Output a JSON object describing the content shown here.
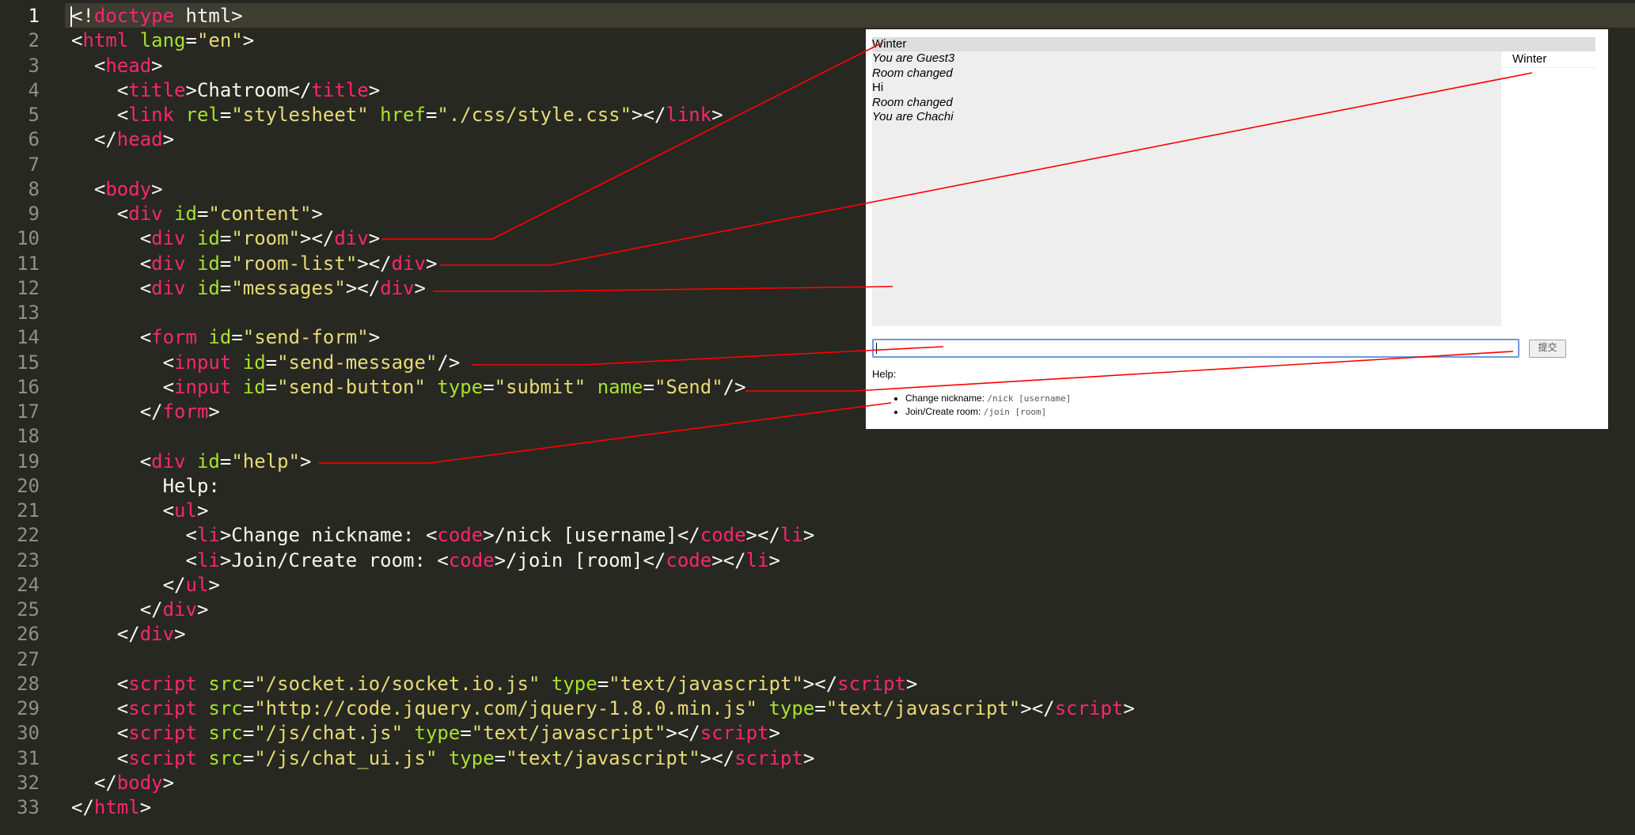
{
  "editor": {
    "line_numbers": [
      "1",
      "2",
      "3",
      "4",
      "5",
      "6",
      "7",
      "8",
      "9",
      "10",
      "11",
      "12",
      "13",
      "14",
      "15",
      "16",
      "17",
      "18",
      "19",
      "20",
      "21",
      "22",
      "23",
      "24",
      "25",
      "26",
      "27",
      "28",
      "29",
      "30",
      "31",
      "32",
      "33"
    ],
    "accent_colors": {
      "background": "#272822",
      "tag": "#f92672",
      "attr": "#a6e22e",
      "string": "#e6db74",
      "text": "#f8f8f2"
    },
    "lines": [
      [
        [
          "p",
          "<!"
        ],
        [
          "t",
          "doctype"
        ],
        [
          "p",
          " html>"
        ]
      ],
      [
        [
          "p",
          "<"
        ],
        [
          "t",
          "html"
        ],
        [
          "p",
          " "
        ],
        [
          "a",
          "lang"
        ],
        [
          "p",
          "="
        ],
        [
          "s",
          "\"en\""
        ],
        [
          "p",
          ">"
        ]
      ],
      [
        [
          "p",
          "  <"
        ],
        [
          "t",
          "head"
        ],
        [
          "p",
          ">"
        ]
      ],
      [
        [
          "p",
          "    <"
        ],
        [
          "t",
          "title"
        ],
        [
          "p",
          ">Chatroom</"
        ],
        [
          "t",
          "title"
        ],
        [
          "p",
          ">"
        ]
      ],
      [
        [
          "p",
          "    <"
        ],
        [
          "t",
          "link"
        ],
        [
          "p",
          " "
        ],
        [
          "a",
          "rel"
        ],
        [
          "p",
          "="
        ],
        [
          "s",
          "\"stylesheet\""
        ],
        [
          "p",
          " "
        ],
        [
          "a",
          "href"
        ],
        [
          "p",
          "="
        ],
        [
          "s",
          "\"./css/style.css\""
        ],
        [
          "p",
          "></"
        ],
        [
          "t",
          "link"
        ],
        [
          "p",
          ">"
        ]
      ],
      [
        [
          "p",
          "  </"
        ],
        [
          "t",
          "head"
        ],
        [
          "p",
          ">"
        ]
      ],
      [],
      [
        [
          "p",
          "  <"
        ],
        [
          "t",
          "body"
        ],
        [
          "p",
          ">"
        ]
      ],
      [
        [
          "p",
          "    <"
        ],
        [
          "t",
          "div"
        ],
        [
          "p",
          " "
        ],
        [
          "a",
          "id"
        ],
        [
          "p",
          "="
        ],
        [
          "s",
          "\"content\""
        ],
        [
          "p",
          ">"
        ]
      ],
      [
        [
          "p",
          "      <"
        ],
        [
          "t",
          "div"
        ],
        [
          "p",
          " "
        ],
        [
          "a",
          "id"
        ],
        [
          "p",
          "="
        ],
        [
          "s",
          "\"room\""
        ],
        [
          "p",
          "></"
        ],
        [
          "t",
          "div"
        ],
        [
          "p",
          ">"
        ]
      ],
      [
        [
          "p",
          "      <"
        ],
        [
          "t",
          "div"
        ],
        [
          "p",
          " "
        ],
        [
          "a",
          "id"
        ],
        [
          "p",
          "="
        ],
        [
          "s",
          "\"room-list\""
        ],
        [
          "p",
          "></"
        ],
        [
          "t",
          "div"
        ],
        [
          "p",
          ">"
        ]
      ],
      [
        [
          "p",
          "      <"
        ],
        [
          "t",
          "div"
        ],
        [
          "p",
          " "
        ],
        [
          "a",
          "id"
        ],
        [
          "p",
          "="
        ],
        [
          "s",
          "\"messages\""
        ],
        [
          "p",
          "></"
        ],
        [
          "t",
          "div"
        ],
        [
          "p",
          ">"
        ]
      ],
      [],
      [
        [
          "p",
          "      <"
        ],
        [
          "t",
          "form"
        ],
        [
          "p",
          " "
        ],
        [
          "a",
          "id"
        ],
        [
          "p",
          "="
        ],
        [
          "s",
          "\"send-form\""
        ],
        [
          "p",
          ">"
        ]
      ],
      [
        [
          "p",
          "        <"
        ],
        [
          "t",
          "input"
        ],
        [
          "p",
          " "
        ],
        [
          "a",
          "id"
        ],
        [
          "p",
          "="
        ],
        [
          "s",
          "\"send-message\""
        ],
        [
          "p",
          "/>"
        ]
      ],
      [
        [
          "p",
          "        <"
        ],
        [
          "t",
          "input"
        ],
        [
          "p",
          " "
        ],
        [
          "a",
          "id"
        ],
        [
          "p",
          "="
        ],
        [
          "s",
          "\"send-button\""
        ],
        [
          "p",
          " "
        ],
        [
          "a",
          "type"
        ],
        [
          "p",
          "="
        ],
        [
          "s",
          "\"submit\""
        ],
        [
          "p",
          " "
        ],
        [
          "a",
          "name"
        ],
        [
          "p",
          "="
        ],
        [
          "s",
          "\"Send\""
        ],
        [
          "p",
          "/>"
        ]
      ],
      [
        [
          "p",
          "      </"
        ],
        [
          "t",
          "form"
        ],
        [
          "p",
          ">"
        ]
      ],
      [],
      [
        [
          "p",
          "      <"
        ],
        [
          "t",
          "div"
        ],
        [
          "p",
          " "
        ],
        [
          "a",
          "id"
        ],
        [
          "p",
          "="
        ],
        [
          "s",
          "\"help\""
        ],
        [
          "p",
          ">"
        ]
      ],
      [
        [
          "p",
          "        Help:"
        ]
      ],
      [
        [
          "p",
          "        <"
        ],
        [
          "t",
          "ul"
        ],
        [
          "p",
          ">"
        ]
      ],
      [
        [
          "p",
          "          <"
        ],
        [
          "t",
          "li"
        ],
        [
          "p",
          ">Change nickname: <"
        ],
        [
          "t",
          "code"
        ],
        [
          "p",
          ">/nick [username]</"
        ],
        [
          "t",
          "code"
        ],
        [
          "p",
          "></"
        ],
        [
          "t",
          "li"
        ],
        [
          "p",
          ">"
        ]
      ],
      [
        [
          "p",
          "          <"
        ],
        [
          "t",
          "li"
        ],
        [
          "p",
          ">Join/Create room: <"
        ],
        [
          "t",
          "code"
        ],
        [
          "p",
          ">/join [room]</"
        ],
        [
          "t",
          "code"
        ],
        [
          "p",
          "></"
        ],
        [
          "t",
          "li"
        ],
        [
          "p",
          ">"
        ]
      ],
      [
        [
          "p",
          "        </"
        ],
        [
          "t",
          "ul"
        ],
        [
          "p",
          ">"
        ]
      ],
      [
        [
          "p",
          "      </"
        ],
        [
          "t",
          "div"
        ],
        [
          "p",
          ">"
        ]
      ],
      [
        [
          "p",
          "    </"
        ],
        [
          "t",
          "div"
        ],
        [
          "p",
          ">"
        ]
      ],
      [],
      [
        [
          "p",
          "    <"
        ],
        [
          "t",
          "script"
        ],
        [
          "p",
          " "
        ],
        [
          "a",
          "src"
        ],
        [
          "p",
          "="
        ],
        [
          "s",
          "\"/socket.io/socket.io.js\""
        ],
        [
          "p",
          " "
        ],
        [
          "a",
          "type"
        ],
        [
          "p",
          "="
        ],
        [
          "s",
          "\"text/javascript\""
        ],
        [
          "p",
          "></"
        ],
        [
          "t",
          "script"
        ],
        [
          "p",
          ">"
        ]
      ],
      [
        [
          "p",
          "    <"
        ],
        [
          "t",
          "script"
        ],
        [
          "p",
          " "
        ],
        [
          "a",
          "src"
        ],
        [
          "p",
          "="
        ],
        [
          "s",
          "\"http://code.jquery.com/jquery-1.8.0.min.js\""
        ],
        [
          "p",
          " "
        ],
        [
          "a",
          "type"
        ],
        [
          "p",
          "="
        ],
        [
          "s",
          "\"text/javascript\""
        ],
        [
          "p",
          "></"
        ],
        [
          "t",
          "script"
        ],
        [
          "p",
          ">"
        ]
      ],
      [
        [
          "p",
          "    <"
        ],
        [
          "t",
          "script"
        ],
        [
          "p",
          " "
        ],
        [
          "a",
          "src"
        ],
        [
          "p",
          "="
        ],
        [
          "s",
          "\"/js/chat.js\""
        ],
        [
          "p",
          " "
        ],
        [
          "a",
          "type"
        ],
        [
          "p",
          "="
        ],
        [
          "s",
          "\"text/javascript\""
        ],
        [
          "p",
          "></"
        ],
        [
          "t",
          "script"
        ],
        [
          "p",
          ">"
        ]
      ],
      [
        [
          "p",
          "    <"
        ],
        [
          "t",
          "script"
        ],
        [
          "p",
          " "
        ],
        [
          "a",
          "src"
        ],
        [
          "p",
          "="
        ],
        [
          "s",
          "\"/js/chat_ui.js\""
        ],
        [
          "p",
          " "
        ],
        [
          "a",
          "type"
        ],
        [
          "p",
          "="
        ],
        [
          "s",
          "\"text/javascript\""
        ],
        [
          "p",
          "></"
        ],
        [
          "t",
          "script"
        ],
        [
          "p",
          ">"
        ]
      ],
      [
        [
          "p",
          "  </"
        ],
        [
          "t",
          "body"
        ],
        [
          "p",
          ">"
        ]
      ],
      [
        [
          "p",
          "</"
        ],
        [
          "t",
          "html"
        ],
        [
          "p",
          ">"
        ]
      ]
    ]
  },
  "preview": {
    "room": "Winter",
    "room_list": [
      "Winter"
    ],
    "messages": [
      {
        "text": "You are Guest3",
        "system": true
      },
      {
        "text": "Room changed",
        "system": true
      },
      {
        "text": "Hi",
        "system": false
      },
      {
        "text": "Room changed",
        "system": true
      },
      {
        "text": "You are Chachi",
        "system": true
      }
    ],
    "input_value": "",
    "submit_label": "提交",
    "help_label": "Help:",
    "help_items": [
      {
        "label": "Change nickname: ",
        "code": "/nick [username]"
      },
      {
        "label": "Join/Create room: ",
        "code": "/join [room]"
      }
    ]
  },
  "annotation_color": "#ff0000"
}
